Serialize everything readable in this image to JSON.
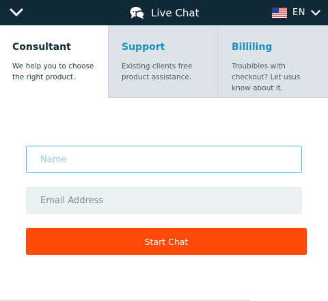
{
  "header": {
    "title": "Live Chat",
    "language": "EN",
    "icons": {
      "collapse": "chevron-down-icon",
      "chat": "chat-bubbles-icon",
      "flag": "us-flag-icon",
      "language_toggle": "chevron-down-icon"
    }
  },
  "tabs": [
    {
      "title": "Consultant",
      "description": "We help you to choose the right product.",
      "active": true
    },
    {
      "title": "Support",
      "description": "Existing clients free product assistance.",
      "active": false
    },
    {
      "title": "Billiling",
      "description": "Troubibles with checkout? Let usus know about it.",
      "active": false
    }
  ],
  "form": {
    "name_placeholder": "Name",
    "email_placeholder": "Email Address",
    "submit_label": "Start Chat"
  },
  "colors": {
    "header_bg": "#0f2936",
    "accent": "#ff4a0a",
    "tab_link": "#1a8fc4",
    "focus_border": "#3dc0e8"
  }
}
